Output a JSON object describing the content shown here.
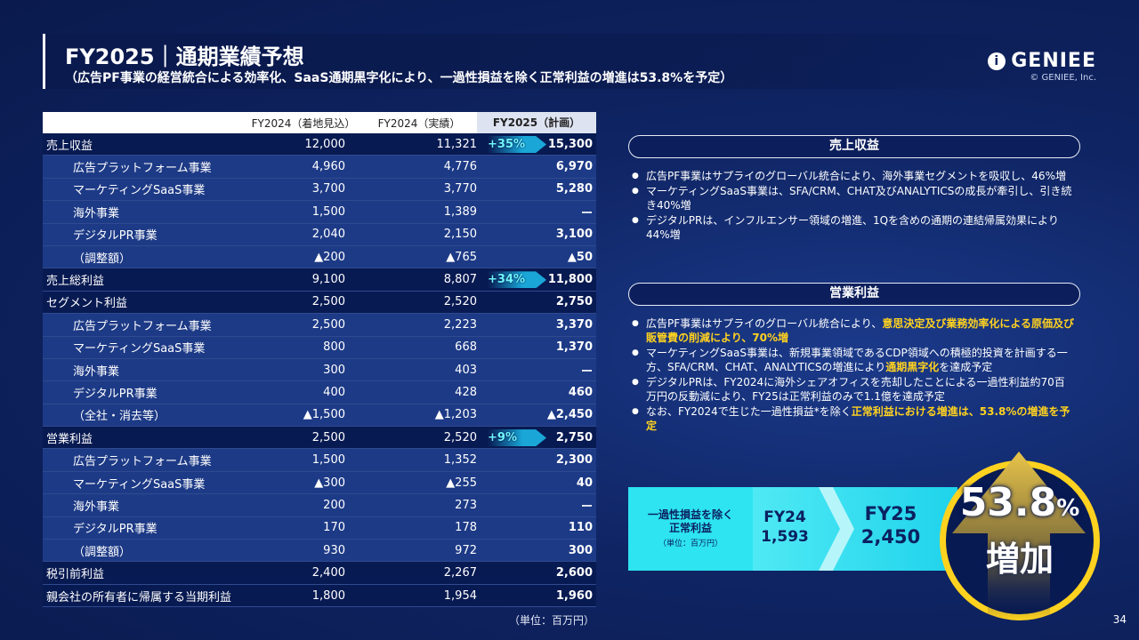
{
  "header": {
    "title": "FY2025｜通期業績予想",
    "subtitle": "（広告PF事業の経営統合による効率化、SaaS通期黒字化により、一過性損益を除く正常利益の増進は53.8%を予定）"
  },
  "logo": {
    "mark": "i",
    "name": "GENIEE",
    "copyright": "© GENIEE, Inc."
  },
  "table": {
    "headers": [
      "",
      "FY2024（着地見込）",
      "FY2024（実績）",
      "FY2025（計画）"
    ],
    "rows": [
      {
        "label": "売上収益",
        "v1": "12,000",
        "v2": "11,321",
        "v3": "15,300",
        "main": true,
        "growth": "+35%"
      },
      {
        "label": "広告プラットフォーム事業",
        "v1": "4,960",
        "v2": "4,776",
        "v3": "6,970",
        "main": false
      },
      {
        "label": "マーケティングSaaS事業",
        "v1": "3,700",
        "v2": "3,770",
        "v3": "5,280",
        "main": false
      },
      {
        "label": "海外事業",
        "v1": "1,500",
        "v2": "1,389",
        "v3": "ー",
        "main": false
      },
      {
        "label": "デジタルPR事業",
        "v1": "2,040",
        "v2": "2,150",
        "v3": "3,100",
        "main": false
      },
      {
        "label": "（調整額）",
        "v1": "▲200",
        "v2": "▲765",
        "v3": "▲50",
        "main": false
      },
      {
        "label": "売上総利益",
        "v1": "9,100",
        "v2": "8,807",
        "v3": "11,800",
        "main": true,
        "growth": "+34%"
      },
      {
        "label": "セグメント利益",
        "v1": "2,500",
        "v2": "2,520",
        "v3": "2,750",
        "main": true
      },
      {
        "label": "広告プラットフォーム事業",
        "v1": "2,500",
        "v2": "2,223",
        "v3": "3,370",
        "main": false
      },
      {
        "label": "マーケティングSaaS事業",
        "v1": "800",
        "v2": "668",
        "v3": "1,370",
        "main": false
      },
      {
        "label": "海外事業",
        "v1": "300",
        "v2": "403",
        "v3": "ー",
        "main": false
      },
      {
        "label": "デジタルPR事業",
        "v1": "400",
        "v2": "428",
        "v3": "460",
        "main": false
      },
      {
        "label": "（全社・消去等）",
        "v1": "▲1,500",
        "v2": "▲1,203",
        "v3": "▲2,450",
        "main": false
      },
      {
        "label": "営業利益",
        "v1": "2,500",
        "v2": "2,520",
        "v3": "2,750",
        "main": true,
        "growth": "+9%"
      },
      {
        "label": "広告プラットフォーム事業",
        "v1": "1,500",
        "v2": "1,352",
        "v3": "2,300",
        "main": false
      },
      {
        "label": "マーケティングSaaS事業",
        "v1": "▲300",
        "v2": "▲255",
        "v3": "40",
        "main": false
      },
      {
        "label": "海外事業",
        "v1": "200",
        "v2": "273",
        "v3": "ー",
        "main": false
      },
      {
        "label": "デジタルPR事業",
        "v1": "170",
        "v2": "178",
        "v3": "110",
        "main": false
      },
      {
        "label": "（調整額）",
        "v1": "930",
        "v2": "972",
        "v3": "300",
        "main": false
      },
      {
        "label": "税引前利益",
        "v1": "2,400",
        "v2": "2,267",
        "v3": "2,600",
        "main": true
      },
      {
        "label": "親会社の所有者に帰属する当期利益",
        "v1": "1,800",
        "v2": "1,954",
        "v3": "1,960",
        "main": true
      }
    ],
    "unit_note": "（単位：百万円）"
  },
  "revenue_section": {
    "heading": "売上収益",
    "bullets": [
      "広告PF事業はサプライのグローバル統合により、海外事業セグメントを吸収し、46%増",
      "マーケティングSaaS事業は、SFA/CRM、CHAT及びANALYTICSの成長が牽引し、引き続き40%増",
      "デジタルPRは、インフルエンサー領域の増進、1Qを含めの通期の連結帰属効果により44%増"
    ]
  },
  "profit_section": {
    "heading": "営業利益",
    "b1_pre": "広告PF事業はサプライのグローバル統合により、",
    "b1_hl": "意思決定及び業務効率化による原価及び販管費の削減により、70%増",
    "b2_pre": "マーケティングSaaS事業は、新規事業領域であるCDP領域への積極的投資を計画する一方、SFA/CRM、CHAT、ANALYTICSの増進により",
    "b2_hl": "通期黒字化",
    "b2_post": "を達成予定",
    "b3": "デジタルPRは、FY2024に海外シェアオフィスを売却したことによる一過性利益約70百万円の反動減により、FY25は正常利益のみで1.1億を達成予定",
    "b4_pre": "なお、FY2024で生じた一過性損益*を除く",
    "b4_hl": "正常利益における増進は、53.8%の増進を予定"
  },
  "kpi": {
    "label_line1": "一過性損益を除く",
    "label_line2": "正常利益",
    "label_unit": "（単位：百万円）",
    "fy24_label": "FY24",
    "fy24_value": "1,593",
    "fy25_label": "FY25",
    "fy25_value": "2,450",
    "pct_number": "53.8",
    "pct_unit": "%",
    "increase_text": "増加"
  },
  "page_number": "34",
  "colors": {
    "accent_yellow": "#ffd21f",
    "accent_cyan": "#2de4f0",
    "navy": "#0a1a4e"
  }
}
